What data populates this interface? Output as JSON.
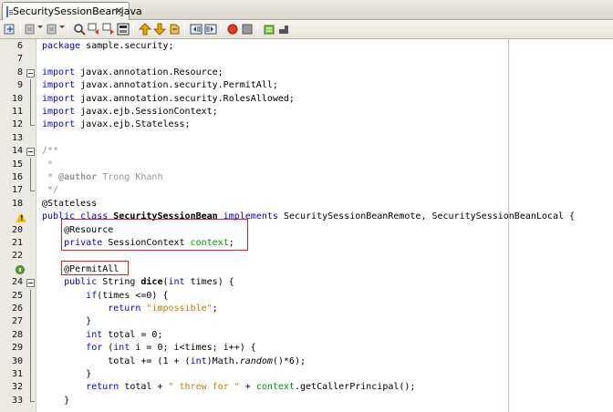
{
  "tab": {
    "label": "SecuritySessionBean.java",
    "close": "×"
  },
  "toolbar": {
    "buttons": [
      "last-edit-icon",
      "back-icon",
      "forward-icon",
      "find-icon",
      "find-prev-icon",
      "find-next-icon",
      "toggle-highlight-icon",
      "prev-bookmark-icon",
      "next-bookmark-icon",
      "toggle-bookmark-icon",
      "shift-left-icon",
      "shift-right-icon",
      "start-macro-icon",
      "stop-macro-icon",
      "comment-icon",
      "uncomment-icon"
    ]
  },
  "editor": {
    "lines": [
      {
        "num": "6",
        "tokens": [
          {
            "t": "package",
            "c": "kw"
          },
          {
            "t": " sample.security;",
            "c": ""
          }
        ]
      },
      {
        "num": "7",
        "tokens": []
      },
      {
        "num": "8",
        "tokens": [
          {
            "t": "import",
            "c": "kw"
          },
          {
            "t": " javax.annotation.Resource;",
            "c": ""
          }
        ],
        "fold": "start"
      },
      {
        "num": "9",
        "tokens": [
          {
            "t": "import",
            "c": "kw"
          },
          {
            "t": " javax.annotation.security.PermitAll;",
            "c": ""
          }
        ],
        "fold": "bar"
      },
      {
        "num": "10",
        "tokens": [
          {
            "t": "import",
            "c": "kw"
          },
          {
            "t": " javax.annotation.security.RolesAllowed;",
            "c": ""
          }
        ],
        "fold": "bar"
      },
      {
        "num": "11",
        "tokens": [
          {
            "t": "import",
            "c": "kw"
          },
          {
            "t": " javax.ejb.SessionContext;",
            "c": ""
          }
        ],
        "fold": "bar"
      },
      {
        "num": "12",
        "tokens": [
          {
            "t": "import",
            "c": "kw"
          },
          {
            "t": " javax.ejb.Stateless;",
            "c": ""
          }
        ],
        "fold": "end"
      },
      {
        "num": "13",
        "tokens": []
      },
      {
        "num": "14",
        "tokens": [
          {
            "t": "/**",
            "c": "cm"
          }
        ],
        "fold": "start"
      },
      {
        "num": "15",
        "tokens": [
          {
            "t": " *",
            "c": "cm"
          }
        ],
        "fold": "bar"
      },
      {
        "num": "16",
        "tokens": [
          {
            "t": " * ",
            "c": "cm"
          },
          {
            "t": "@author",
            "c": "cm cls"
          },
          {
            "t": " Trong Khanh",
            "c": "cm"
          }
        ],
        "fold": "bar"
      },
      {
        "num": "17",
        "tokens": [
          {
            "t": " */",
            "c": "cm"
          }
        ],
        "fold": "end"
      },
      {
        "num": "18",
        "tokens": [
          {
            "t": "@Stateless",
            "c": "an"
          }
        ]
      },
      {
        "num": "",
        "icon": "warning",
        "tokens": [
          {
            "t": "public class ",
            "c": "kw"
          },
          {
            "t": "SecuritySessionBean",
            "c": "cls"
          },
          {
            "t": " ",
            "c": ""
          },
          {
            "t": "implements",
            "c": "kw"
          },
          {
            "t": " SecuritySessionBeanRemote, SecuritySessionBeanLocal {",
            "c": ""
          }
        ]
      },
      {
        "num": "20",
        "tokens": [
          {
            "t": "    @Resource",
            "c": "an"
          }
        ]
      },
      {
        "num": "21",
        "tokens": [
          {
            "t": "    ",
            "c": ""
          },
          {
            "t": "private",
            "c": "kw"
          },
          {
            "t": " SessionContext ",
            "c": ""
          },
          {
            "t": "context",
            "c": "fld"
          },
          {
            "t": ";",
            "c": ""
          }
        ]
      },
      {
        "num": "22",
        "tokens": []
      },
      {
        "num": "",
        "icon": "hint",
        "tokens": [
          {
            "t": "    @PermitAll",
            "c": "an"
          }
        ]
      },
      {
        "num": "24",
        "tokens": [
          {
            "t": "    ",
            "c": ""
          },
          {
            "t": "public",
            "c": "kw"
          },
          {
            "t": " String ",
            "c": ""
          },
          {
            "t": "dice",
            "c": "cls"
          },
          {
            "t": "(",
            "c": ""
          },
          {
            "t": "int",
            "c": "kw"
          },
          {
            "t": " times) {",
            "c": ""
          }
        ],
        "fold": "start"
      },
      {
        "num": "25",
        "tokens": [
          {
            "t": "        ",
            "c": ""
          },
          {
            "t": "if",
            "c": "kw"
          },
          {
            "t": "(times <=0) {",
            "c": ""
          }
        ],
        "fold": "bar"
      },
      {
        "num": "26",
        "tokens": [
          {
            "t": "            ",
            "c": ""
          },
          {
            "t": "return",
            "c": "kw"
          },
          {
            "t": " ",
            "c": ""
          },
          {
            "t": "\"impossible\"",
            "c": "str"
          },
          {
            "t": ";",
            "c": ""
          }
        ],
        "fold": "bar"
      },
      {
        "num": "27",
        "tokens": [
          {
            "t": "        }",
            "c": ""
          }
        ],
        "fold": "bar"
      },
      {
        "num": "28",
        "tokens": [
          {
            "t": "        ",
            "c": ""
          },
          {
            "t": "int",
            "c": "kw"
          },
          {
            "t": " total = 0;",
            "c": ""
          }
        ],
        "fold": "bar"
      },
      {
        "num": "29",
        "tokens": [
          {
            "t": "        ",
            "c": ""
          },
          {
            "t": "for",
            "c": "kw"
          },
          {
            "t": " (",
            "c": ""
          },
          {
            "t": "int",
            "c": "kw"
          },
          {
            "t": " i = 0; i<times; i++) {",
            "c": ""
          }
        ],
        "fold": "bar"
      },
      {
        "num": "30",
        "tokens": [
          {
            "t": "            total += (1 + (",
            "c": ""
          },
          {
            "t": "int",
            "c": "kw"
          },
          {
            "t": ")Math.",
            "c": ""
          },
          {
            "t": "random",
            "c": "it"
          },
          {
            "t": "()*6);",
            "c": ""
          }
        ],
        "fold": "bar"
      },
      {
        "num": "31",
        "tokens": [
          {
            "t": "        }",
            "c": ""
          }
        ],
        "fold": "bar"
      },
      {
        "num": "32",
        "tokens": [
          {
            "t": "        ",
            "c": ""
          },
          {
            "t": "return",
            "c": "kw"
          },
          {
            "t": " total + ",
            "c": ""
          },
          {
            "t": "\" threw for \"",
            "c": "str"
          },
          {
            "t": " + ",
            "c": ""
          },
          {
            "t": "context",
            "c": "fld"
          },
          {
            "t": ".getCallerPrincipal();",
            "c": ""
          }
        ],
        "fold": "bar"
      },
      {
        "num": "33",
        "tokens": [
          {
            "t": "    }",
            "c": ""
          }
        ],
        "fold": "end"
      }
    ]
  },
  "colors": {
    "keyword": "#0000e6",
    "comment": "#969696",
    "string": "#ce7b00",
    "field": "#009900",
    "highlight_box": "#e02020"
  }
}
